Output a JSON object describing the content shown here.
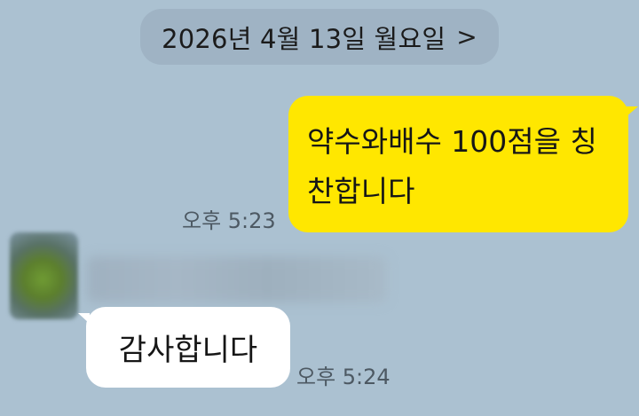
{
  "date_separator": {
    "label": "2026년 4월 13일 월요일",
    "chevron_icon": "chevron-right-icon",
    "chevron_glyph": ">"
  },
  "messages": [
    {
      "direction": "outgoing",
      "text": "약수와배수 100점을 칭찬합니다",
      "time": "오후 5:23",
      "bubble_color": "#ffe700"
    },
    {
      "direction": "incoming",
      "text": "감사합니다",
      "time": "오후 5:24",
      "bubble_color": "#ffffff"
    }
  ],
  "colors": {
    "background": "#abc1d1",
    "date_pill": "#9fb3c4",
    "time_text": "#4d5963"
  }
}
